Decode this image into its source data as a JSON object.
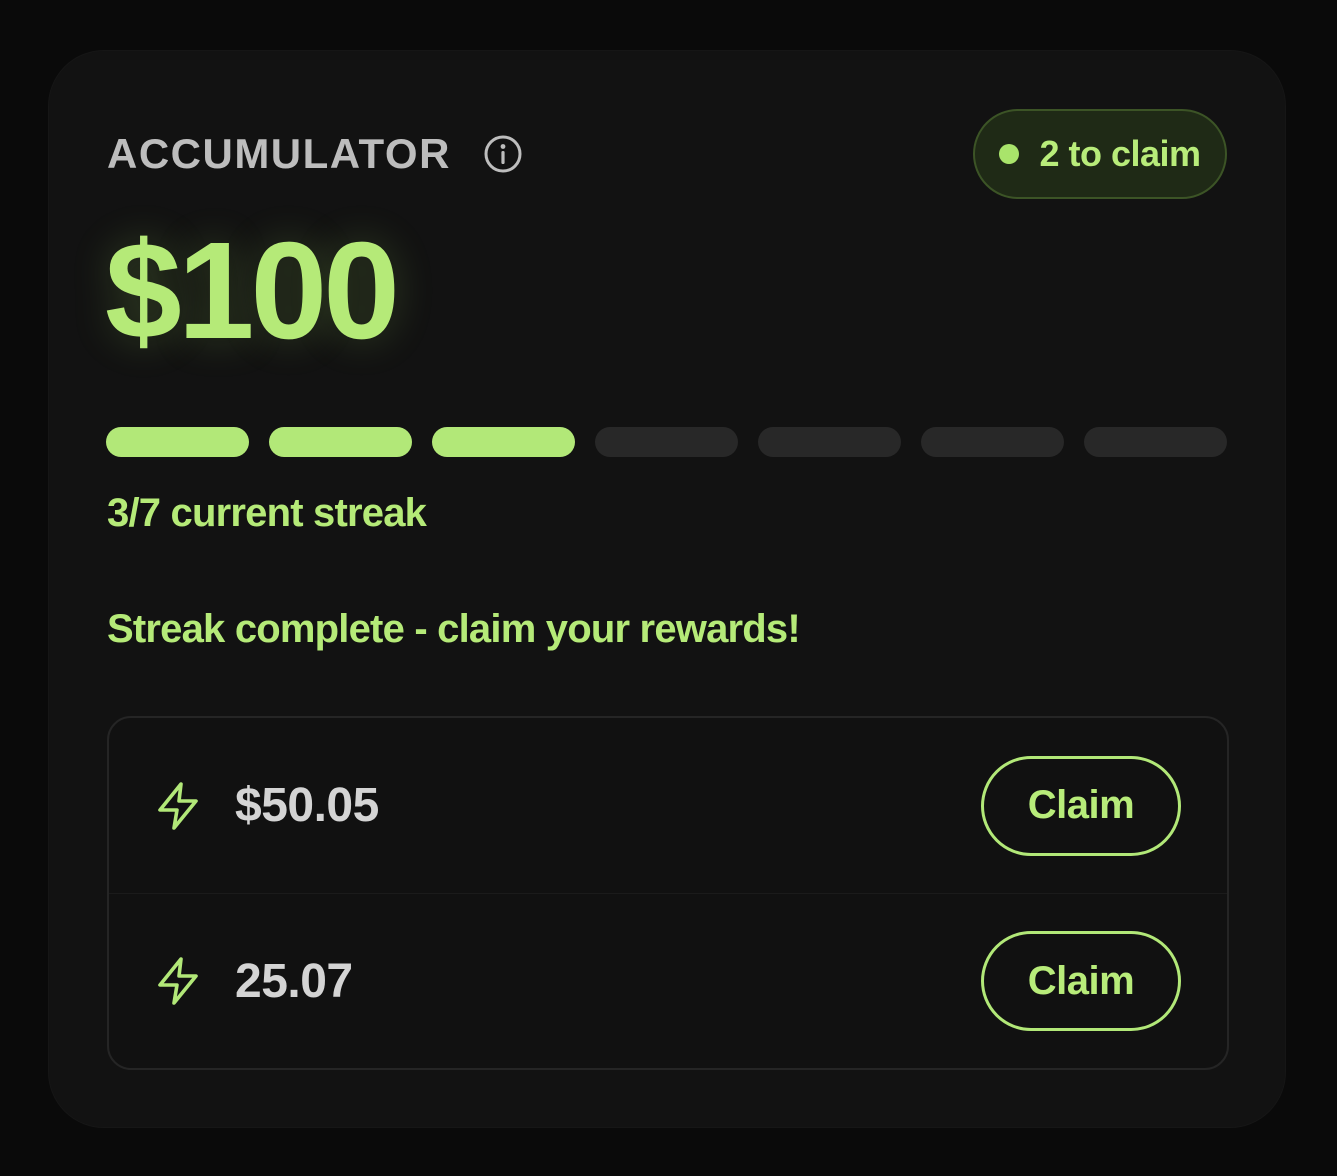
{
  "card": {
    "title": "ACCUMULATOR",
    "info_icon": "info-icon",
    "badge": {
      "label": "2 to claim",
      "dot_icon": "status-dot-icon"
    },
    "amount": "$100",
    "streak": {
      "current": 3,
      "total": 7,
      "label": "3/7 current streak"
    },
    "status_message": "Streak complete - claim your rewards!",
    "rewards": [
      {
        "icon": "lightning-bolt-icon",
        "amount": "$50.05",
        "button_label": "Claim"
      },
      {
        "icon": "lightning-bolt-icon",
        "amount": "25.07",
        "button_label": "Claim"
      }
    ]
  },
  "colors": {
    "background": "#0a0a0a",
    "card": "#121212",
    "accent": "#b2e878",
    "muted_text": "#bdbdbd",
    "empty_segment": "#282828"
  }
}
